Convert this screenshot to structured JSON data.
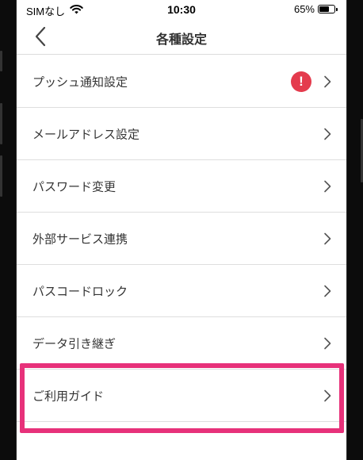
{
  "status_bar": {
    "carrier": "SIMなし",
    "time": "10:30",
    "battery_percent": "65%",
    "battery_level": 0.65,
    "wifi_icon": "wifi-icon"
  },
  "nav": {
    "title": "各種設定",
    "back_icon": "chevron-left-icon"
  },
  "settings": [
    {
      "label": "プッシュ通知設定",
      "alert": "!"
    },
    {
      "label": "メールアドレス設定"
    },
    {
      "label": "パスワード変更"
    },
    {
      "label": "外部サービス連携"
    },
    {
      "label": "パスコードロック"
    },
    {
      "label": "データ引き継ぎ"
    },
    {
      "label": "ご利用ガイド"
    }
  ],
  "colors": {
    "alert": "#e43b4d",
    "highlight": "#e7317a"
  }
}
